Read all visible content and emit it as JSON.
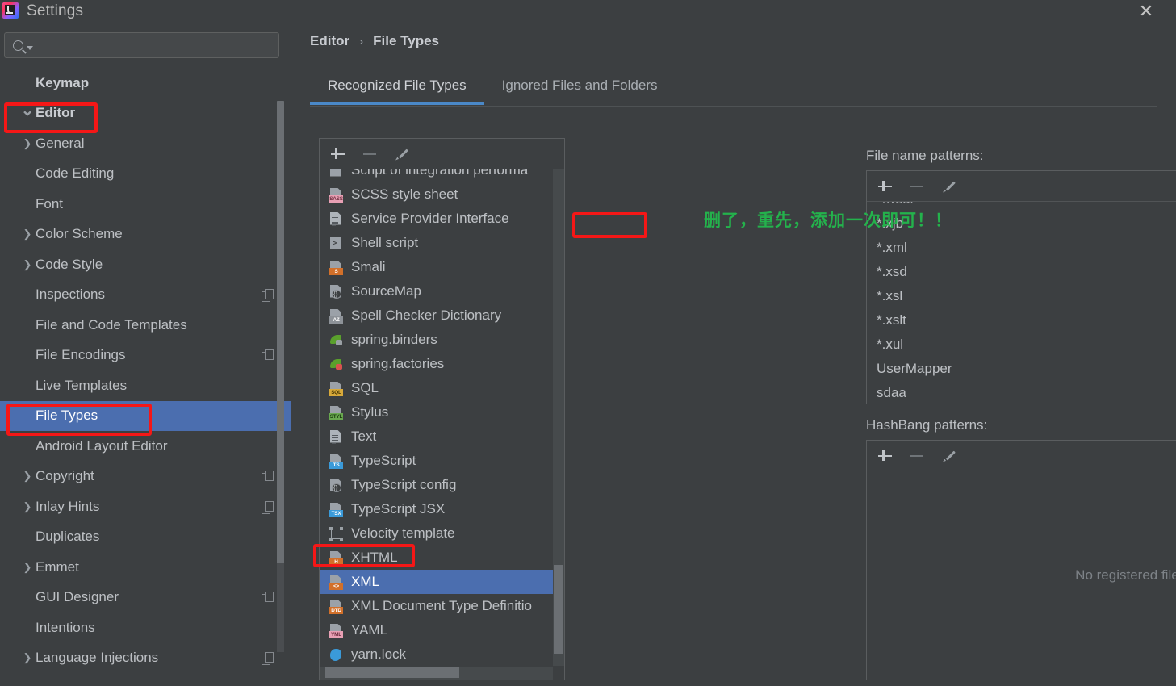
{
  "window": {
    "title": "Settings",
    "logo_icon": "intellij-idea-logo",
    "close_icon": "close-icon"
  },
  "sidebar": {
    "search": {
      "placeholder": "",
      "value": "",
      "icon": "search-icon",
      "caret_icon": "chevron-down-icon"
    },
    "items": [
      {
        "label": "Keymap",
        "level": 0,
        "chevron": "",
        "bold": true,
        "selected": false,
        "badge": false
      },
      {
        "label": "Editor",
        "level": 0,
        "chevron": "v",
        "bold": true,
        "selected": false,
        "badge": false
      },
      {
        "label": "General",
        "level": 1,
        "chevron": ">",
        "bold": false,
        "selected": false,
        "badge": false
      },
      {
        "label": "Code Editing",
        "level": 1,
        "chevron": "",
        "bold": false,
        "selected": false,
        "badge": false
      },
      {
        "label": "Font",
        "level": 1,
        "chevron": "",
        "bold": false,
        "selected": false,
        "badge": false
      },
      {
        "label": "Color Scheme",
        "level": 1,
        "chevron": ">",
        "bold": false,
        "selected": false,
        "badge": false
      },
      {
        "label": "Code Style",
        "level": 1,
        "chevron": ">",
        "bold": false,
        "selected": false,
        "badge": false
      },
      {
        "label": "Inspections",
        "level": 1,
        "chevron": "",
        "bold": false,
        "selected": false,
        "badge": true
      },
      {
        "label": "File and Code Templates",
        "level": 1,
        "chevron": "",
        "bold": false,
        "selected": false,
        "badge": false
      },
      {
        "label": "File Encodings",
        "level": 1,
        "chevron": "",
        "bold": false,
        "selected": false,
        "badge": true
      },
      {
        "label": "Live Templates",
        "level": 1,
        "chevron": "",
        "bold": false,
        "selected": false,
        "badge": false
      },
      {
        "label": "File Types",
        "level": 1,
        "chevron": "",
        "bold": false,
        "selected": true,
        "badge": false
      },
      {
        "label": "Android Layout Editor",
        "level": 1,
        "chevron": "",
        "bold": false,
        "selected": false,
        "badge": false
      },
      {
        "label": "Copyright",
        "level": 1,
        "chevron": ">",
        "bold": false,
        "selected": false,
        "badge": true
      },
      {
        "label": "Inlay Hints",
        "level": 1,
        "chevron": ">",
        "bold": false,
        "selected": false,
        "badge": true
      },
      {
        "label": "Duplicates",
        "level": 1,
        "chevron": "",
        "bold": false,
        "selected": false,
        "badge": false
      },
      {
        "label": "Emmet",
        "level": 1,
        "chevron": ">",
        "bold": false,
        "selected": false,
        "badge": false
      },
      {
        "label": "GUI Designer",
        "level": 1,
        "chevron": "",
        "bold": false,
        "selected": false,
        "badge": true
      },
      {
        "label": "Intentions",
        "level": 1,
        "chevron": "",
        "bold": false,
        "selected": false,
        "badge": false
      },
      {
        "label": "Language Injections",
        "level": 1,
        "chevron": ">",
        "bold": false,
        "selected": false,
        "badge": true
      }
    ]
  },
  "main": {
    "breadcrumb": {
      "parent": "Editor",
      "separator": "›",
      "current": "File Types"
    },
    "tabs": [
      {
        "label": "Recognized File Types",
        "active": true
      },
      {
        "label": "Ignored Files and Folders",
        "active": false
      }
    ],
    "file_types_toolbar": [
      {
        "name": "add-file-type-button",
        "icon": "plus-icon",
        "enabled": true
      },
      {
        "name": "remove-file-type-button",
        "icon": "minus-icon",
        "enabled": false
      },
      {
        "name": "edit-file-type-button",
        "icon": "pencil-icon",
        "enabled": true
      }
    ],
    "file_types": [
      {
        "label": "Script of integration performa",
        "icon": "file-icon",
        "tag": "",
        "tag_color": "#6e7378",
        "selected": false,
        "clipped": true
      },
      {
        "label": "SCSS style sheet",
        "icon": "file-icon",
        "tag": "SASS",
        "tag_color": "#e8a0b4",
        "selected": false
      },
      {
        "label": "Service Provider Interface",
        "icon": "text-file-icon",
        "tag": "",
        "tag_color": "",
        "selected": false
      },
      {
        "label": "Shell script",
        "icon": "shell-icon",
        "tag": "",
        "tag_color": "",
        "selected": false
      },
      {
        "label": "Smali",
        "icon": "file-icon",
        "tag": "S",
        "tag_color": "#d2702a",
        "selected": false
      },
      {
        "label": "SourceMap",
        "icon": "json-file-icon",
        "tag": "",
        "tag_color": "",
        "selected": false
      },
      {
        "label": "Spell Checker Dictionary",
        "icon": "file-icon",
        "tag": "AZ",
        "tag_color": "#8d9298",
        "selected": false
      },
      {
        "label": "spring.binders",
        "icon": "spring-leaf-icon",
        "tag": "",
        "tag_color": "",
        "selected": false
      },
      {
        "label": "spring.factories",
        "icon": "spring-leaf-icon",
        "tag": "",
        "tag_color": "",
        "selected": false
      },
      {
        "label": "SQL",
        "icon": "file-icon",
        "tag": "SQL",
        "tag_color": "#d8a93a",
        "selected": false
      },
      {
        "label": "Stylus",
        "icon": "file-icon",
        "tag": "STYL",
        "tag_color": "#69a84f",
        "selected": false
      },
      {
        "label": "Text",
        "icon": "text-file-icon",
        "tag": "",
        "tag_color": "",
        "selected": false
      },
      {
        "label": "TypeScript",
        "icon": "file-icon",
        "tag": "TS",
        "tag_color": "#3a9ad9",
        "selected": false
      },
      {
        "label": "TypeScript config",
        "icon": "json-file-icon",
        "tag": "",
        "tag_color": "",
        "selected": false
      },
      {
        "label": "TypeScript JSX",
        "icon": "file-icon",
        "tag": "TSX",
        "tag_color": "#3a9ad9",
        "selected": false
      },
      {
        "label": "Velocity template",
        "icon": "velocity-icon",
        "tag": "",
        "tag_color": "",
        "selected": false
      },
      {
        "label": "XHTML",
        "icon": "file-icon",
        "tag": "H",
        "tag_color": "#d2702a",
        "selected": false
      },
      {
        "label": "XML",
        "icon": "file-icon",
        "tag": "<>",
        "tag_color": "#d2702a",
        "selected": true
      },
      {
        "label": "XML Document Type Definitio",
        "icon": "file-icon",
        "tag": "DTD",
        "tag_color": "#d2702a",
        "selected": false,
        "clipped": true
      },
      {
        "label": "YAML",
        "icon": "file-icon",
        "tag": "YML",
        "tag_color": "#e8a0b4",
        "selected": false
      },
      {
        "label": "yarn.lock",
        "icon": "yarn-icon",
        "tag": "",
        "tag_color": "",
        "selected": false
      }
    ],
    "file_name_patterns": {
      "label": "File name patterns:",
      "toolbar": [
        {
          "name": "add-pattern-button",
          "icon": "plus-icon",
          "enabled": true
        },
        {
          "name": "remove-pattern-button",
          "icon": "minus-icon",
          "enabled": false
        },
        {
          "name": "edit-pattern-button",
          "icon": "pencil-icon",
          "enabled": true
        }
      ],
      "items": [
        {
          "value": "*.wsdl",
          "clipped": true
        },
        {
          "value": "*.xjb"
        },
        {
          "value": "*.xml",
          "highlighted": true
        },
        {
          "value": "*.xsd"
        },
        {
          "value": "*.xsl"
        },
        {
          "value": "*.xslt"
        },
        {
          "value": "*.xul"
        },
        {
          "value": "UserMapper"
        },
        {
          "value": "sdaa"
        }
      ]
    },
    "hashbang_patterns": {
      "label": "HashBang patterns:",
      "toolbar": [
        {
          "name": "add-hashbang-button",
          "icon": "plus-icon",
          "enabled": true
        },
        {
          "name": "remove-hashbang-button",
          "icon": "minus-icon",
          "enabled": false
        },
        {
          "name": "edit-hashbang-button",
          "icon": "pencil-icon",
          "enabled": true
        }
      ],
      "empty_text": "No registered file patterns"
    }
  },
  "annotations": {
    "note_text": "删了，重先，添加一次即可！！",
    "note_color": "#24b24c",
    "box_color": "#f51717"
  }
}
